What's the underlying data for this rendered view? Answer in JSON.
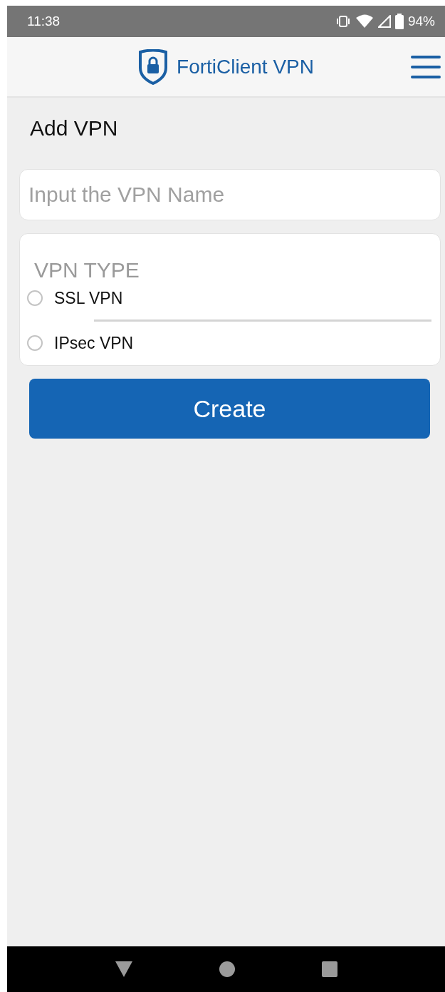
{
  "status_bar": {
    "time": "11:38",
    "battery": "94%"
  },
  "header": {
    "title": "FortiClient VPN"
  },
  "page_title": "Add VPN",
  "name_field": {
    "placeholder": "Input the VPN Name"
  },
  "vpn_type": {
    "label": "VPN TYPE",
    "options": [
      {
        "label": "SSL VPN",
        "selected": false
      },
      {
        "label": "IPsec VPN",
        "selected": false
      }
    ]
  },
  "create_button": "Create"
}
